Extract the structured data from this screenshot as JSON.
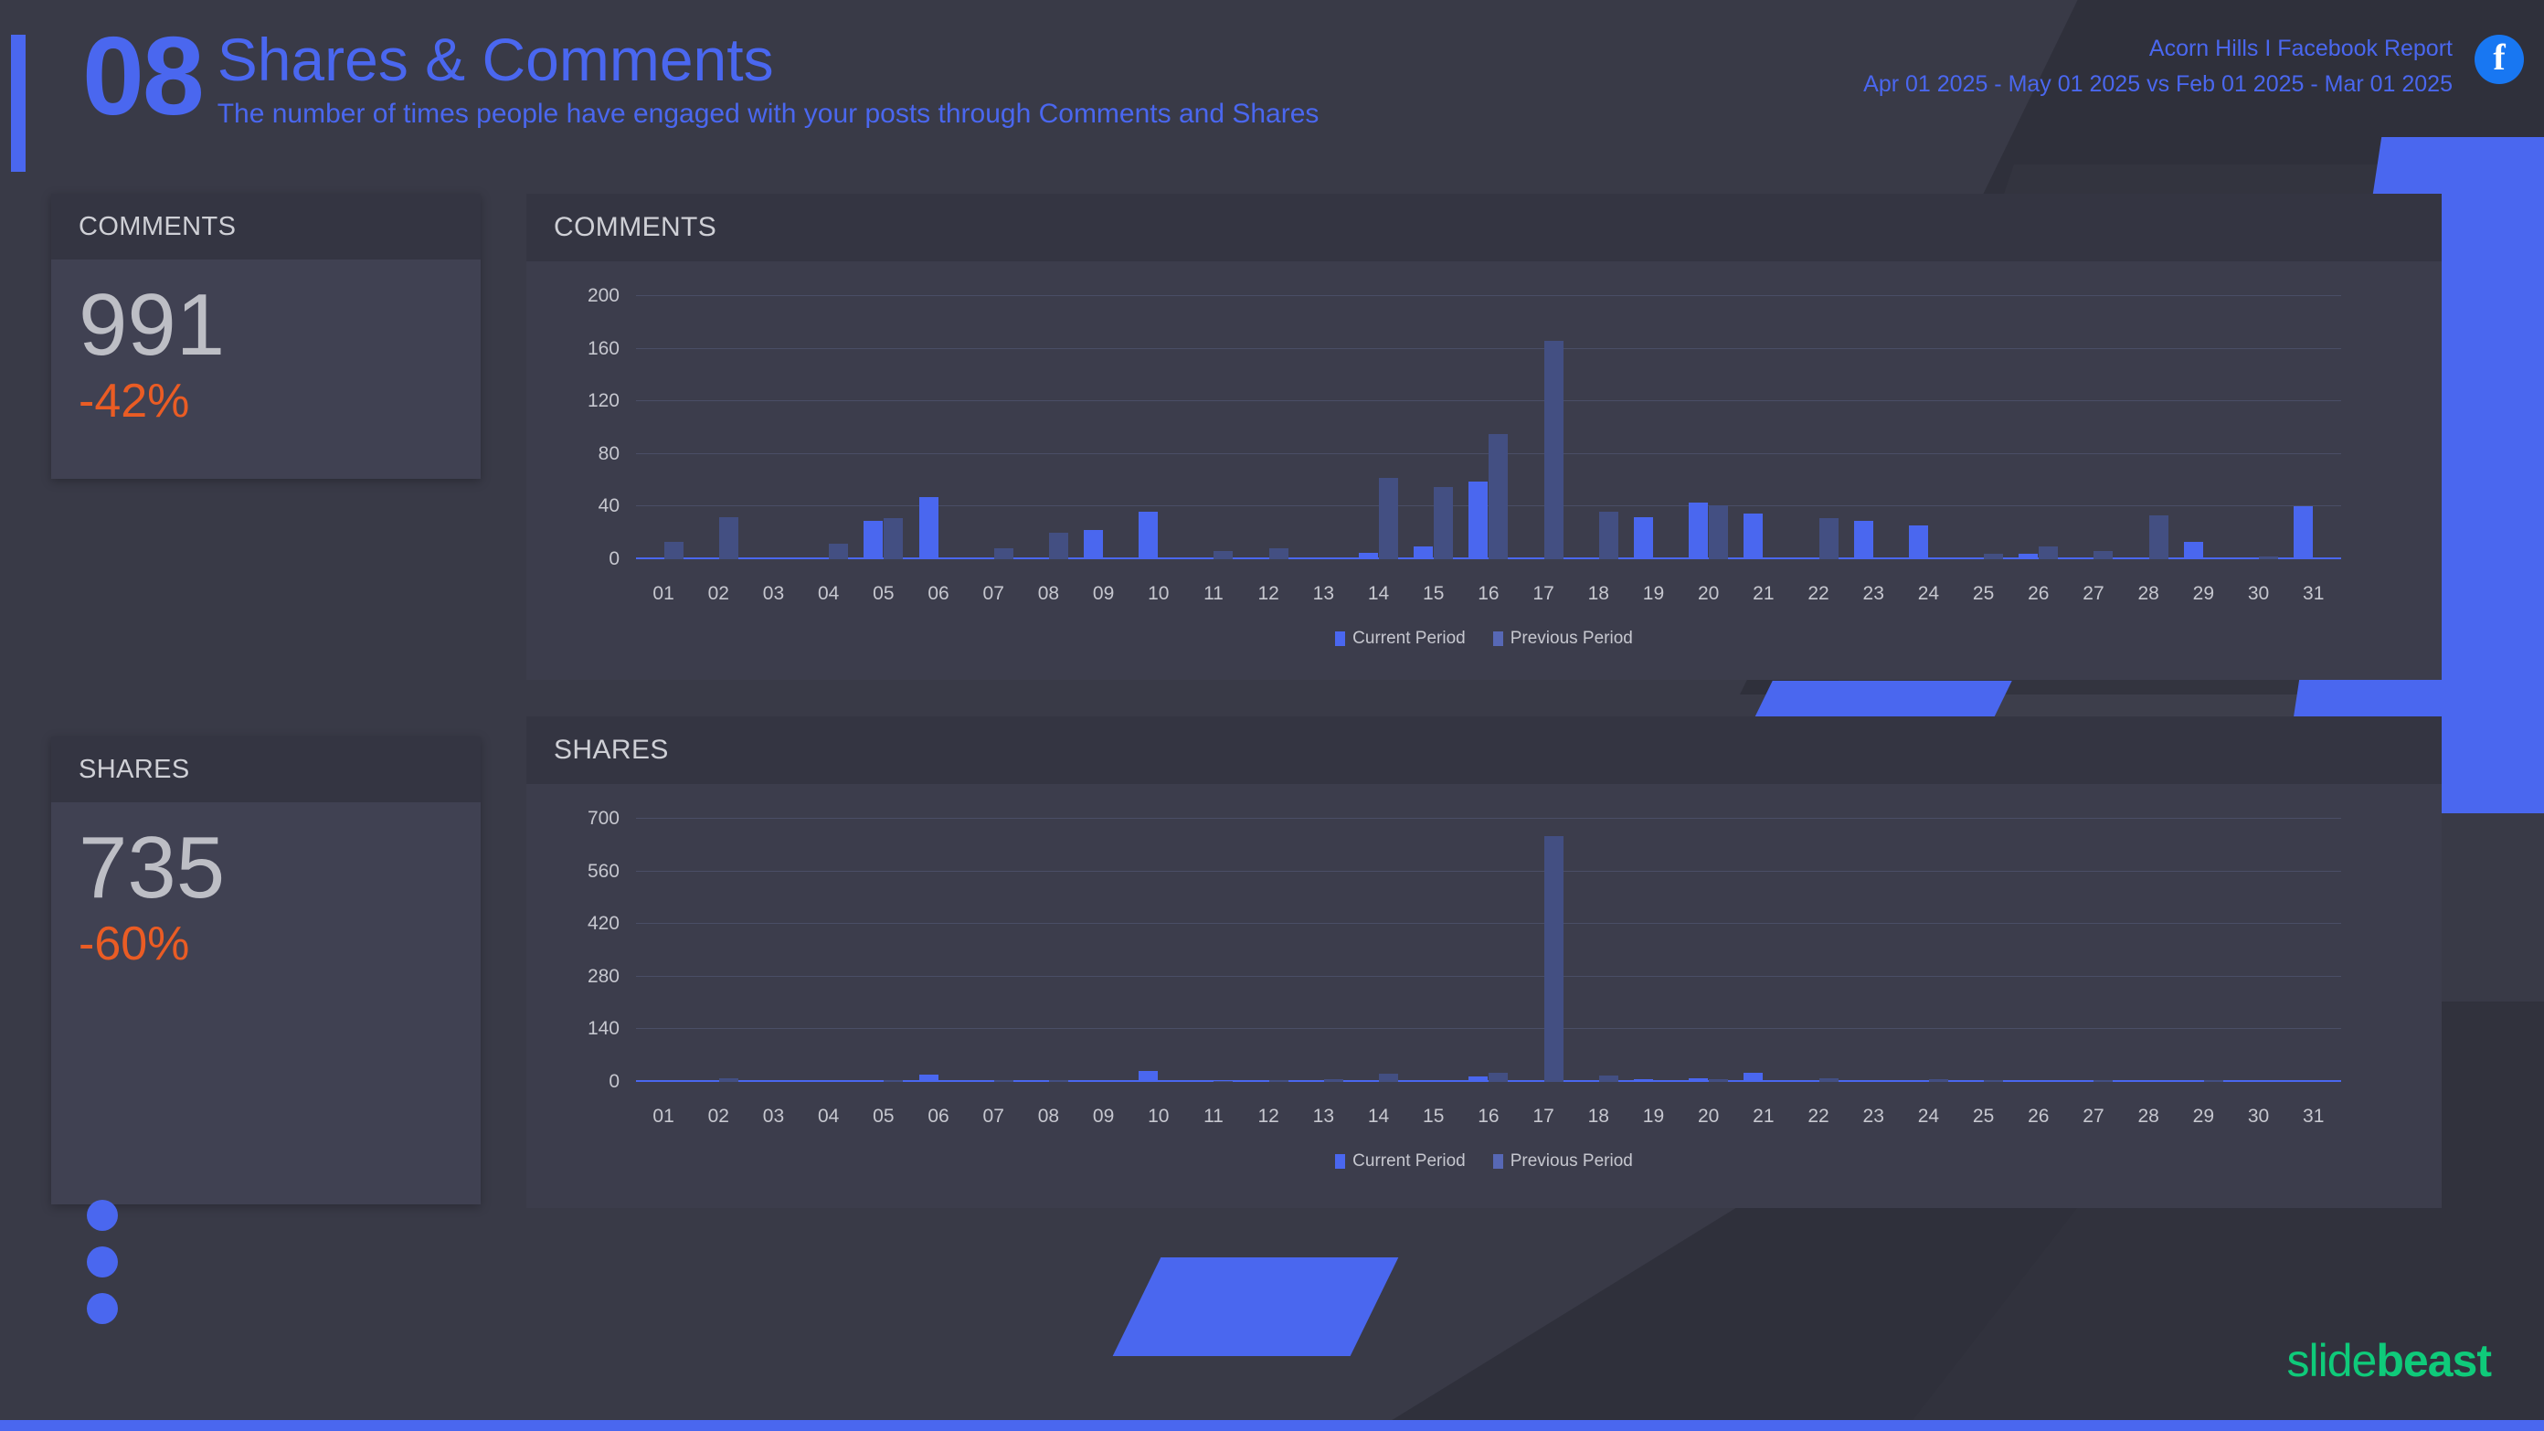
{
  "header": {
    "number": "08",
    "title": "Shares & Comments",
    "subtitle": "The number of times people have engaged with your posts through Comments and Shares",
    "account_line": "Acorn Hills  I Facebook Report",
    "date_line": "Apr 01 2025 - May 01 2025 vs Feb 01 2025 - Mar 01 2025",
    "platform_icon": "facebook-icon",
    "platform_glyph": "f"
  },
  "kpis": [
    {
      "label": "COMMENTS",
      "value": "991",
      "delta": "-42%"
    },
    {
      "label": "SHARES",
      "value": "735",
      "delta": "-60%"
    }
  ],
  "legend": {
    "current": "Current Period",
    "previous": "Previous Period"
  },
  "brand": {
    "part1": "slide",
    "part2": "beast"
  },
  "colors": {
    "accent": "#4a67ef",
    "current_period": "#4a67ef",
    "previous_period": "#434f82",
    "negative": "#ea5c24",
    "brand_green": "#0fca7a",
    "panel_bg": "#3c3d4c",
    "panel_head_bg": "#343542",
    "page_bg": "#393a47"
  },
  "chart_data": [
    {
      "type": "bar",
      "title": "COMMENTS",
      "xlabel": "",
      "ylabel": "",
      "ylim": [
        0,
        200
      ],
      "yticks": [
        0,
        40,
        80,
        120,
        160,
        200
      ],
      "grid": true,
      "legend_position": "bottom",
      "categories": [
        "01",
        "02",
        "03",
        "04",
        "05",
        "06",
        "07",
        "08",
        "09",
        "10",
        "11",
        "12",
        "13",
        "14",
        "15",
        "16",
        "17",
        "18",
        "19",
        "20",
        "21",
        "22",
        "23",
        "24",
        "25",
        "26",
        "27",
        "28",
        "29",
        "30",
        "31"
      ],
      "series": [
        {
          "name": "Current Period",
          "values": [
            0,
            0,
            0,
            0,
            29,
            47,
            0,
            0,
            22,
            36,
            0,
            0,
            0,
            5,
            10,
            59,
            0,
            0,
            32,
            43,
            35,
            0,
            29,
            26,
            0,
            4,
            0,
            0,
            13,
            0,
            40
          ]
        },
        {
          "name": "Previous Period",
          "values": [
            13,
            32,
            0,
            12,
            31,
            0,
            8,
            20,
            0,
            0,
            6,
            8,
            0,
            62,
            55,
            95,
            166,
            36,
            0,
            41,
            0,
            31,
            0,
            0,
            4,
            10,
            6,
            33,
            0,
            2,
            0
          ]
        }
      ]
    },
    {
      "type": "bar",
      "title": "SHARES",
      "xlabel": "",
      "ylabel": "",
      "ylim": [
        0,
        700
      ],
      "yticks": [
        0,
        140,
        280,
        420,
        560,
        700
      ],
      "grid": true,
      "legend_position": "bottom",
      "categories": [
        "01",
        "02",
        "03",
        "04",
        "05",
        "06",
        "07",
        "08",
        "09",
        "10",
        "11",
        "12",
        "13",
        "14",
        "15",
        "16",
        "17",
        "18",
        "19",
        "20",
        "21",
        "22",
        "23",
        "24",
        "25",
        "26",
        "27",
        "28",
        "29",
        "30",
        "31"
      ],
      "series": [
        {
          "name": "Current Period",
          "values": [
            0,
            0,
            0,
            0,
            6,
            20,
            0,
            0,
            0,
            28,
            0,
            0,
            0,
            0,
            5,
            14,
            0,
            0,
            8,
            10,
            24,
            0,
            0,
            0,
            0,
            0,
            0,
            5,
            0,
            0,
            5
          ]
        },
        {
          "name": "Previous Period",
          "values": [
            0,
            10,
            0,
            0,
            5,
            0,
            4,
            6,
            0,
            0,
            3,
            4,
            8,
            22,
            0,
            24,
            655,
            16,
            0,
            8,
            0,
            10,
            0,
            8,
            5,
            0,
            4,
            0,
            5,
            0,
            0
          ]
        }
      ]
    }
  ]
}
